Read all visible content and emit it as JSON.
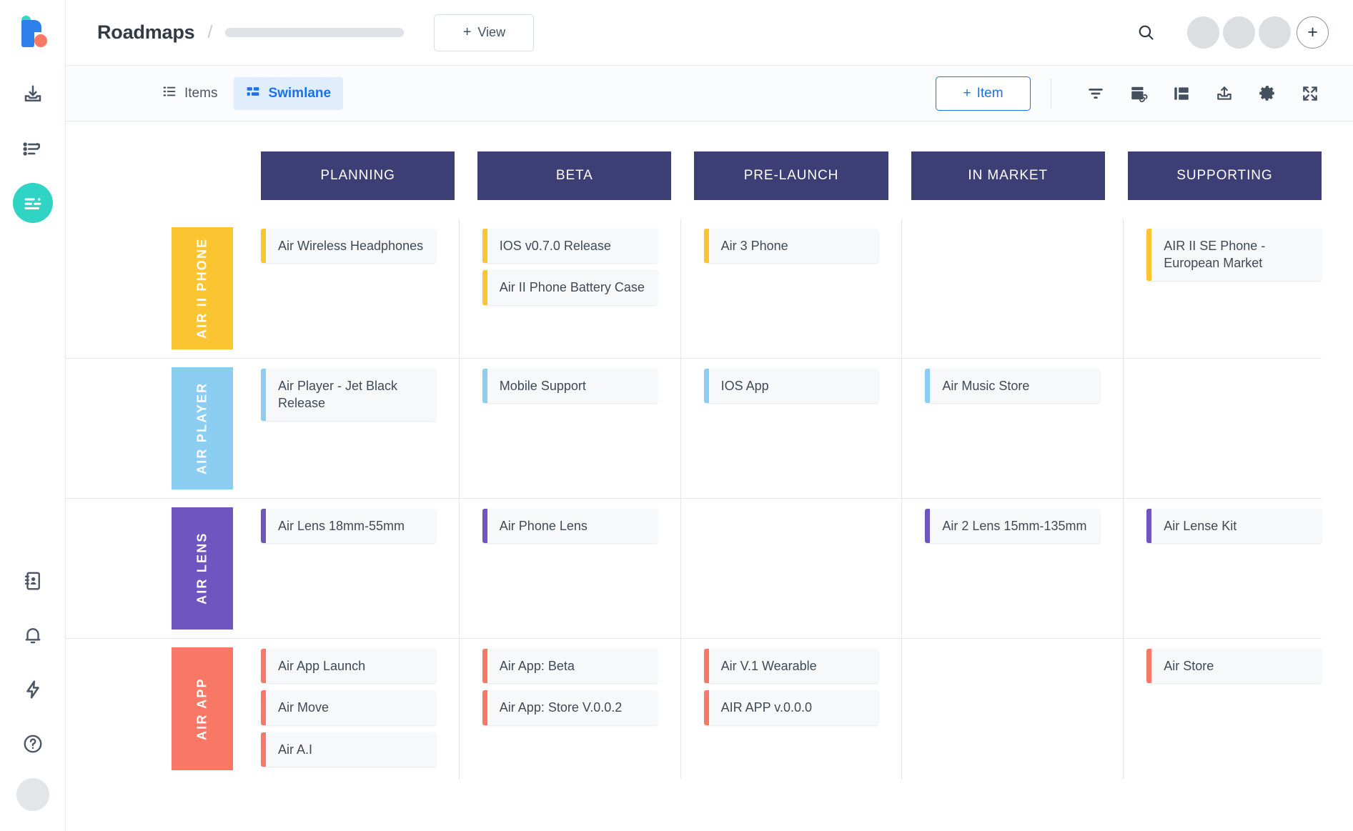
{
  "app": {
    "logo": "productboard-logo",
    "page_title": "Roadmaps",
    "breadcrumb_separator": "/",
    "breadcrumb_placeholder": ""
  },
  "header": {
    "view_button_label": "View",
    "view_button_plus": "+",
    "search_icon": "search-icon",
    "avatar_add_label": "+",
    "avatars": [
      "avatar-1",
      "avatar-2",
      "avatar-3"
    ]
  },
  "toolbar": {
    "tabs": [
      {
        "label": "Items",
        "icon": "list-icon",
        "active": false
      },
      {
        "label": "Swimlane",
        "icon": "swimlane-icon",
        "active": true
      }
    ],
    "add_item_label": "Item",
    "add_item_plus": "+",
    "icons": [
      {
        "name": "filter-icon"
      },
      {
        "name": "link-board-icon"
      },
      {
        "name": "layout-columns-icon"
      },
      {
        "name": "export-upload-icon"
      },
      {
        "name": "settings-gear-icon"
      },
      {
        "name": "fullscreen-expand-icon"
      }
    ]
  },
  "board": {
    "columns": [
      "PLANNING",
      "BETA",
      "PRE-LAUNCH",
      "IN MARKET",
      "SUPPORTING"
    ],
    "column_header_color": "#3c3e75",
    "lanes": [
      {
        "label": "AIR II PHONE",
        "color": "#fbc531",
        "cells": [
          {
            "cards": [
              {
                "title": "Air Wireless Headphones"
              }
            ]
          },
          {
            "cards": [
              {
                "title": "IOS v0.7.0 Release"
              },
              {
                "title": "Air II Phone Battery Case"
              }
            ]
          },
          {
            "cards": [
              {
                "title": "Air 3 Phone"
              }
            ]
          },
          {
            "cards": []
          },
          {
            "cards": [
              {
                "title": "AIR II SE Phone - European Market"
              }
            ]
          }
        ]
      },
      {
        "label": "AIR PLAYER",
        "color": "#8ccdf2",
        "cells": [
          {
            "cards": [
              {
                "title": "Air Player - Jet Black Release"
              }
            ]
          },
          {
            "cards": [
              {
                "title": "Mobile Support"
              }
            ]
          },
          {
            "cards": [
              {
                "title": "IOS App"
              }
            ]
          },
          {
            "cards": [
              {
                "title": "Air Music Store"
              }
            ]
          },
          {
            "cards": []
          }
        ]
      },
      {
        "label": "AIR LENS",
        "color": "#6e55c0",
        "cells": [
          {
            "cards": [
              {
                "title": "Air Lens 18mm-55mm"
              }
            ]
          },
          {
            "cards": [
              {
                "title": "Air Phone Lens"
              }
            ]
          },
          {
            "cards": []
          },
          {
            "cards": [
              {
                "title": "Air 2 Lens 15mm-135mm"
              }
            ]
          },
          {
            "cards": [
              {
                "title": "Air Lense Kit"
              }
            ]
          }
        ]
      },
      {
        "label": "AIR APP",
        "color": "#f87868",
        "cells": [
          {
            "cards": [
              {
                "title": "Air App Launch"
              },
              {
                "title": "Air Move"
              },
              {
                "title": "Air A.I"
              }
            ]
          },
          {
            "cards": [
              {
                "title": "Air App: Beta"
              },
              {
                "title": "Air App: Store V.0.0.2"
              }
            ]
          },
          {
            "cards": [
              {
                "title": "Air V.1 Wearable"
              },
              {
                "title": "AIR APP v.0.0.0"
              }
            ]
          },
          {
            "cards": []
          },
          {
            "cards": [
              {
                "title": "Air Store"
              }
            ]
          }
        ]
      }
    ]
  },
  "sidebar": {
    "items": [
      {
        "name": "inbox-download-icon",
        "active": false
      },
      {
        "name": "insights-list-icon",
        "active": false
      },
      {
        "name": "roadmap-board-icon",
        "active": true
      }
    ],
    "bottom_items": [
      {
        "name": "address-book-icon"
      },
      {
        "name": "notifications-bell-icon"
      },
      {
        "name": "integrations-bolt-icon"
      },
      {
        "name": "help-question-icon"
      }
    ],
    "avatar": "user-avatar"
  }
}
